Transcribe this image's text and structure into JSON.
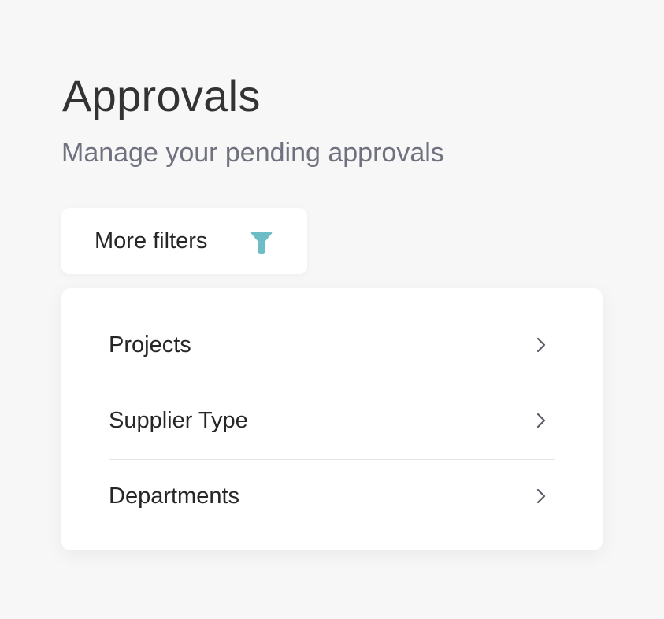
{
  "header": {
    "title": "Approvals",
    "subtitle": "Manage your pending approvals"
  },
  "filter_button": {
    "label": "More filters",
    "icon": "funnel-icon",
    "icon_color": "#6dbcc6"
  },
  "filter_menu": {
    "items": [
      {
        "label": "Projects",
        "icon": "chevron-right-icon"
      },
      {
        "label": "Supplier Type",
        "icon": "chevron-right-icon"
      },
      {
        "label": "Departments",
        "icon": "chevron-right-icon"
      }
    ]
  },
  "colors": {
    "background": "#f7f7f7",
    "title": "#333333",
    "subtitle": "#70717f",
    "text": "#262626",
    "divider": "#e4e4e4",
    "chevron": "#5b5d66"
  }
}
